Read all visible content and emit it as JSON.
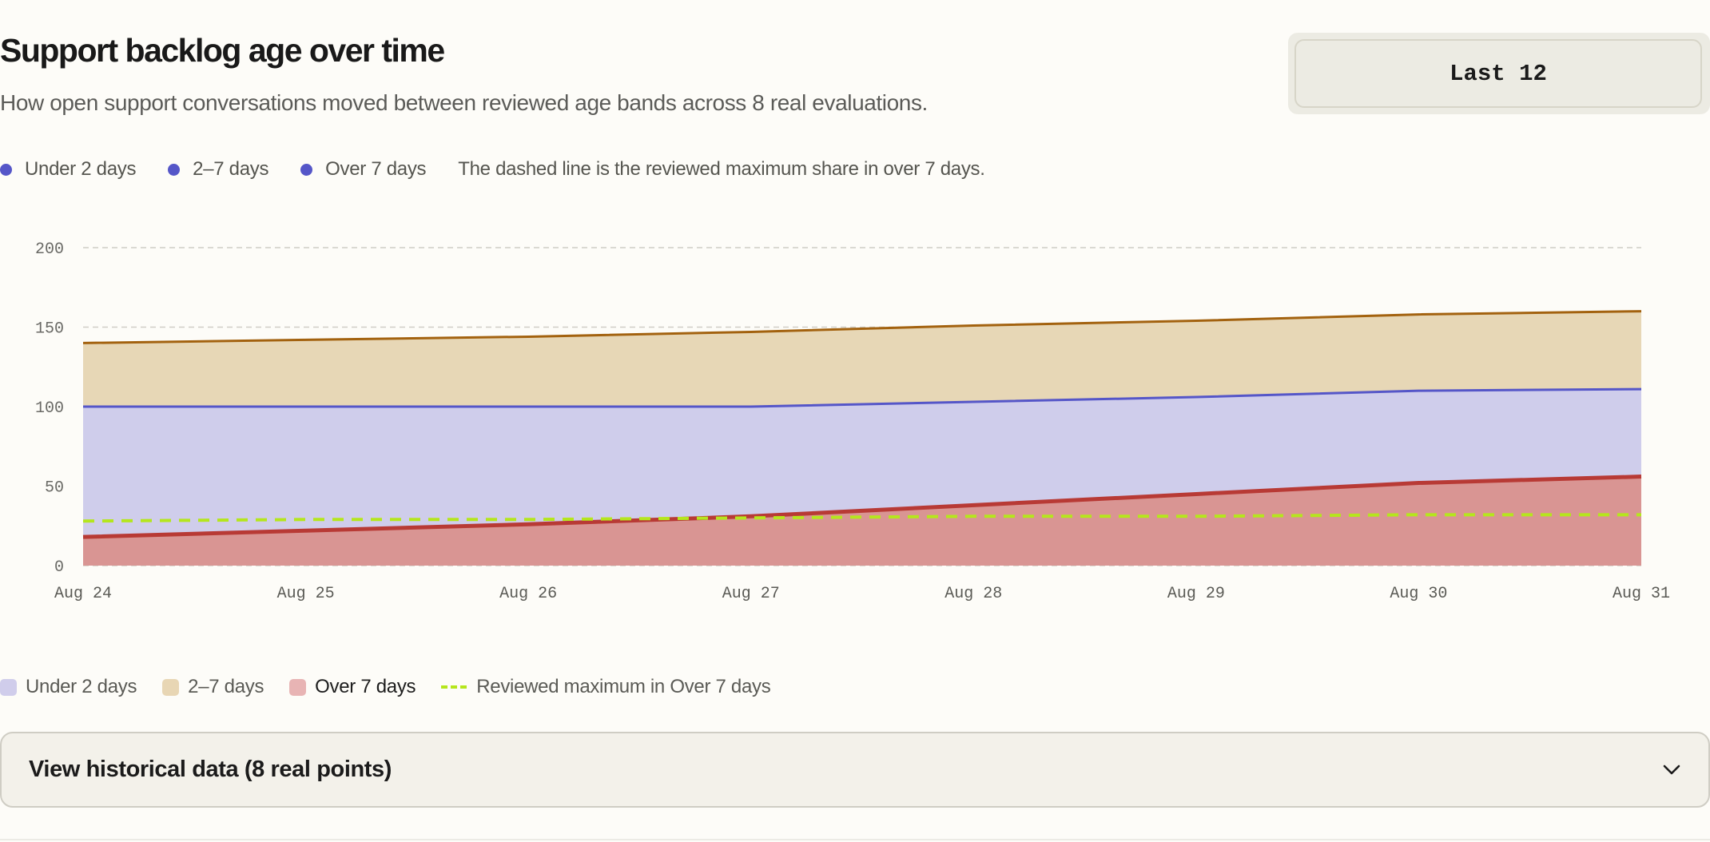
{
  "header": {
    "title": "Support backlog age over time",
    "subtitle": "How open support conversations moved between reviewed age bands across 8 real evaluations."
  },
  "range_button": {
    "label": "Last 12"
  },
  "top_legend": {
    "items": [
      "Under 2 days",
      "2–7 days",
      "Over 7 days"
    ],
    "note": "The dashed line is the reviewed maximum share in over 7 days."
  },
  "bottom_legend": {
    "items": [
      {
        "label": "Under 2 days",
        "color": "#d0cdeb"
      },
      {
        "label": "2–7 days",
        "color": "#e8d6b4"
      },
      {
        "label": "Over 7 days",
        "color": "#e8b4b4"
      }
    ],
    "reference_label": "Reviewed maximum in Over 7 days"
  },
  "history": {
    "label": "View historical data (8 real points)"
  },
  "chart_data": {
    "type": "area",
    "stacked": true,
    "categories": [
      "Aug 24",
      "Aug 25",
      "Aug 26",
      "Aug 27",
      "Aug 28",
      "Aug 29",
      "Aug 30",
      "Aug 31"
    ],
    "ylim": [
      0,
      200
    ],
    "yticks": [
      0,
      50,
      100,
      150,
      200
    ],
    "grid": true,
    "series": [
      {
        "name": "Over 7 days",
        "values": [
          18,
          22,
          26,
          31,
          38,
          45,
          52,
          56
        ],
        "fill": "#d99593",
        "stroke": "#b83a35"
      },
      {
        "name": "Under 2 days",
        "values": [
          82,
          78,
          74,
          69,
          65,
          61,
          58,
          55
        ],
        "fill": "#cfcdeb",
        "stroke": "#5556c8"
      },
      {
        "name": "2–7 days",
        "values": [
          40,
          42,
          44,
          47,
          48,
          48,
          48,
          49
        ],
        "fill": "#e7d7b6",
        "stroke": "#a3620f"
      }
    ],
    "reference": {
      "name": "Reviewed maximum in Over 7 days",
      "values": [
        28,
        29,
        29,
        30,
        31,
        31,
        32,
        32
      ],
      "color": "#b5e61d"
    }
  }
}
